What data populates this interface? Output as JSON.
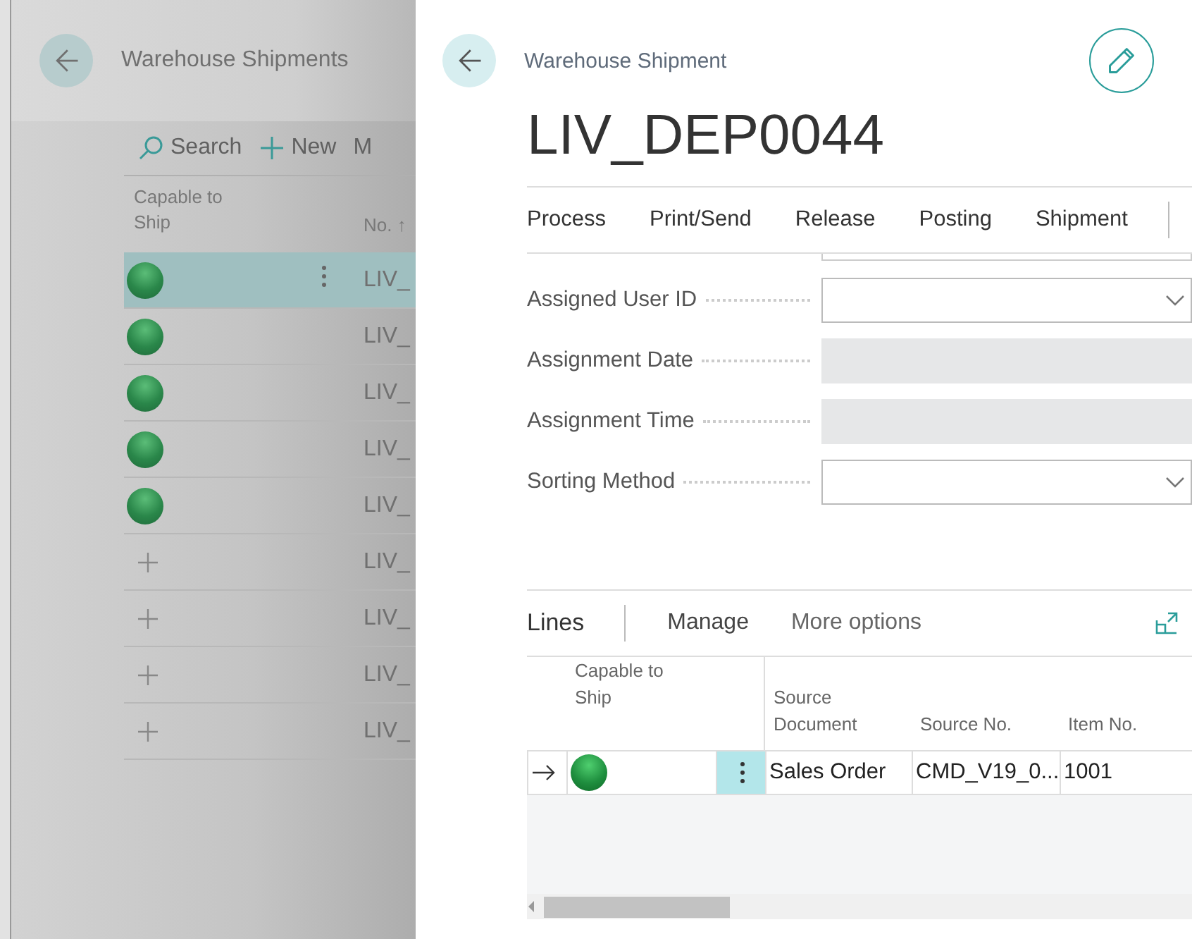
{
  "list_page": {
    "title": "Warehouse Shipments",
    "actions": [
      {
        "kind": "search",
        "label": "Search"
      },
      {
        "kind": "new",
        "label": "New"
      },
      {
        "kind": "text",
        "label": "M"
      }
    ],
    "columns": [
      "Capable to Ship",
      "No. ↑"
    ],
    "rows": [
      {
        "kind": "capable",
        "no": "LIV_",
        "selected": true
      },
      {
        "kind": "capable",
        "no": "LIV_",
        "selected": false
      },
      {
        "kind": "capable",
        "no": "LIV_",
        "selected": false
      },
      {
        "kind": "capable",
        "no": "LIV_",
        "selected": false
      },
      {
        "kind": "capable",
        "no": "LIV_",
        "selected": false
      },
      {
        "kind": "none",
        "no": "LIV_",
        "selected": false
      },
      {
        "kind": "none",
        "no": "LIV_",
        "selected": false
      },
      {
        "kind": "none",
        "no": "LIV_",
        "selected": false
      },
      {
        "kind": "none",
        "no": "LIV_",
        "selected": false
      }
    ]
  },
  "card": {
    "caption": "Warehouse Shipment",
    "title": "LIV_DEP0044",
    "actions": [
      "Process",
      "Print/Send",
      "Release",
      "Posting",
      "Shipment"
    ],
    "fields": [
      {
        "label": "Assigned User ID",
        "kind": "dropdown"
      },
      {
        "label": "Assignment Date",
        "kind": "readonly"
      },
      {
        "label": "Assignment Time",
        "kind": "readonly"
      },
      {
        "label": "Sorting Method",
        "kind": "dropdown"
      }
    ],
    "lines": {
      "title": "Lines",
      "actions": [
        "Manage",
        "More options"
      ],
      "columns": [
        "Capable to Ship",
        "Source Document",
        "Source No.",
        "Item No."
      ],
      "rows": [
        {
          "kind": "capable",
          "source_document": "Sales Order",
          "source_no": "CMD_V19_0...",
          "item_no": "1001"
        }
      ]
    }
  }
}
